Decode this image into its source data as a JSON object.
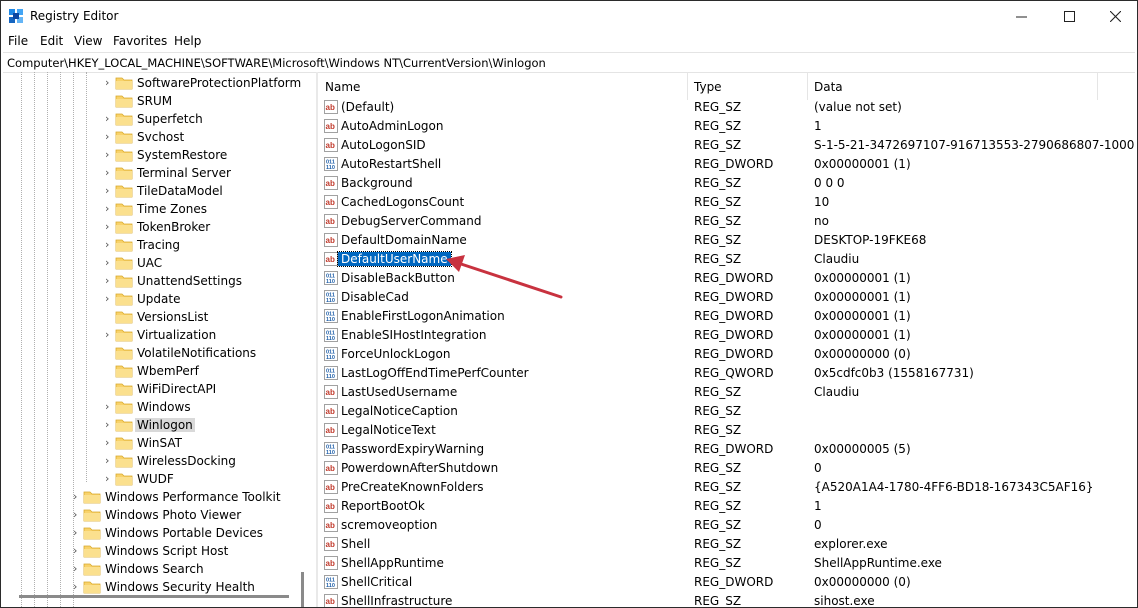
{
  "window": {
    "title": "Registry Editor"
  },
  "menu": [
    "File",
    "Edit",
    "View",
    "Favorites",
    "Help"
  ],
  "address": "Computer\\HKEY_LOCAL_MACHINE\\SOFTWARE\\Microsoft\\Windows NT\\CurrentVersion\\Winlogon",
  "tree": {
    "items": [
      {
        "label": "SoftwareProtectionPlatform",
        "expandable": true
      },
      {
        "label": "SRUM",
        "expandable": false
      },
      {
        "label": "Superfetch",
        "expandable": true
      },
      {
        "label": "Svchost",
        "expandable": true
      },
      {
        "label": "SystemRestore",
        "expandable": true
      },
      {
        "label": "Terminal Server",
        "expandable": true
      },
      {
        "label": "TileDataModel",
        "expandable": true
      },
      {
        "label": "Time Zones",
        "expandable": true
      },
      {
        "label": "TokenBroker",
        "expandable": true
      },
      {
        "label": "Tracing",
        "expandable": true
      },
      {
        "label": "UAC",
        "expandable": true
      },
      {
        "label": "UnattendSettings",
        "expandable": true
      },
      {
        "label": "Update",
        "expandable": true
      },
      {
        "label": "VersionsList",
        "expandable": false
      },
      {
        "label": "Virtualization",
        "expandable": true
      },
      {
        "label": "VolatileNotifications",
        "expandable": false
      },
      {
        "label": "WbemPerf",
        "expandable": false
      },
      {
        "label": "WiFiDirectAPI",
        "expandable": false
      },
      {
        "label": "Windows",
        "expandable": true
      },
      {
        "label": "Winlogon",
        "expandable": true,
        "selected": true
      },
      {
        "label": "WinSAT",
        "expandable": true
      },
      {
        "label": "WirelessDocking",
        "expandable": true
      },
      {
        "label": "WUDF",
        "expandable": true
      },
      {
        "label": "Windows Performance Toolkit",
        "expandable": true,
        "level": 1
      },
      {
        "label": "Windows Photo Viewer",
        "expandable": true,
        "level": 1
      },
      {
        "label": "Windows Portable Devices",
        "expandable": true,
        "level": 1
      },
      {
        "label": "Windows Script Host",
        "expandable": true,
        "level": 1
      },
      {
        "label": "Windows Search",
        "expandable": true,
        "level": 1
      },
      {
        "label": "Windows Security Health",
        "expandable": true,
        "level": 1
      }
    ]
  },
  "columns": {
    "name": "Name",
    "type": "Type",
    "data": "Data"
  },
  "values": [
    {
      "icon": "string-value-icon",
      "name": "(Default)",
      "type": "REG_SZ",
      "data": "(value not set)"
    },
    {
      "icon": "string-value-icon",
      "name": "AutoAdminLogon",
      "type": "REG_SZ",
      "data": "1"
    },
    {
      "icon": "string-value-icon",
      "name": "AutoLogonSID",
      "type": "REG_SZ",
      "data": "S-1-5-21-3472697107-916713553-2790686807-1000"
    },
    {
      "icon": "binary-value-icon",
      "name": "AutoRestartShell",
      "type": "REG_DWORD",
      "data": "0x00000001 (1)"
    },
    {
      "icon": "string-value-icon",
      "name": "Background",
      "type": "REG_SZ",
      "data": "0 0 0"
    },
    {
      "icon": "string-value-icon",
      "name": "CachedLogonsCount",
      "type": "REG_SZ",
      "data": "10"
    },
    {
      "icon": "string-value-icon",
      "name": "DebugServerCommand",
      "type": "REG_SZ",
      "data": "no"
    },
    {
      "icon": "string-value-icon",
      "name": "DefaultDomainName",
      "type": "REG_SZ",
      "data": "DESKTOP-19FKE68"
    },
    {
      "icon": "string-value-icon",
      "name": "DefaultUserName",
      "type": "REG_SZ",
      "data": "Claudiu",
      "selected": true
    },
    {
      "icon": "binary-value-icon",
      "name": "DisableBackButton",
      "type": "REG_DWORD",
      "data": "0x00000001 (1)"
    },
    {
      "icon": "binary-value-icon",
      "name": "DisableCad",
      "type": "REG_DWORD",
      "data": "0x00000001 (1)"
    },
    {
      "icon": "binary-value-icon",
      "name": "EnableFirstLogonAnimation",
      "type": "REG_DWORD",
      "data": "0x00000001 (1)"
    },
    {
      "icon": "binary-value-icon",
      "name": "EnableSIHostIntegration",
      "type": "REG_DWORD",
      "data": "0x00000001 (1)"
    },
    {
      "icon": "binary-value-icon",
      "name": "ForceUnlockLogon",
      "type": "REG_DWORD",
      "data": "0x00000000 (0)"
    },
    {
      "icon": "binary-value-icon",
      "name": "LastLogOffEndTimePerfCounter",
      "type": "REG_QWORD",
      "data": "0x5cdfc0b3 (1558167731)"
    },
    {
      "icon": "string-value-icon",
      "name": "LastUsedUsername",
      "type": "REG_SZ",
      "data": "Claudiu"
    },
    {
      "icon": "string-value-icon",
      "name": "LegalNoticeCaption",
      "type": "REG_SZ",
      "data": ""
    },
    {
      "icon": "string-value-icon",
      "name": "LegalNoticeText",
      "type": "REG_SZ",
      "data": ""
    },
    {
      "icon": "binary-value-icon",
      "name": "PasswordExpiryWarning",
      "type": "REG_DWORD",
      "data": "0x00000005 (5)"
    },
    {
      "icon": "string-value-icon",
      "name": "PowerdownAfterShutdown",
      "type": "REG_SZ",
      "data": "0"
    },
    {
      "icon": "string-value-icon",
      "name": "PreCreateKnownFolders",
      "type": "REG_SZ",
      "data": "{A520A1A4-1780-4FF6-BD18-167343C5AF16}"
    },
    {
      "icon": "string-value-icon",
      "name": "ReportBootOk",
      "type": "REG_SZ",
      "data": "1"
    },
    {
      "icon": "string-value-icon",
      "name": "scremoveoption",
      "type": "REG_SZ",
      "data": "0"
    },
    {
      "icon": "string-value-icon",
      "name": "Shell",
      "type": "REG_SZ",
      "data": "explorer.exe"
    },
    {
      "icon": "string-value-icon",
      "name": "ShellAppRuntime",
      "type": "REG_SZ",
      "data": "ShellAppRuntime.exe"
    },
    {
      "icon": "binary-value-icon",
      "name": "ShellCritical",
      "type": "REG_DWORD",
      "data": "0x00000000 (0)"
    },
    {
      "icon": "string-value-icon",
      "name": "ShellInfrastructure",
      "type": "REG_SZ",
      "data": "sihost.exe"
    }
  ],
  "colors": {
    "selection": "#0067c0",
    "folder": "#f8d26a",
    "string_icon": "#c0392b",
    "binary_icon": "#1f5fa8",
    "annotation_arrow": "#c8323f"
  }
}
